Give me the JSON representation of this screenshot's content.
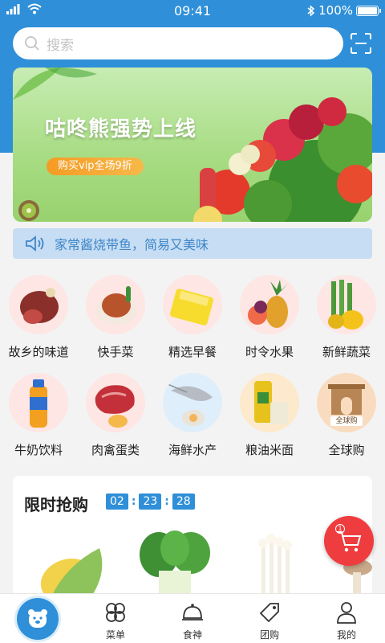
{
  "status_bar": {
    "time": "09:41",
    "battery": "100%"
  },
  "search": {
    "placeholder": "搜索"
  },
  "banner": {
    "title": "咕咚熊强势上线",
    "tag": "购买vip全场9折"
  },
  "notice": {
    "text": "家常酱烧带鱼，简易又美味"
  },
  "categories": [
    {
      "label": "故乡的味道"
    },
    {
      "label": "快手菜"
    },
    {
      "label": "精选早餐"
    },
    {
      "label": "时令水果"
    },
    {
      "label": "新鲜蔬菜"
    },
    {
      "label": "牛奶饮料"
    },
    {
      "label": "肉禽蛋类"
    },
    {
      "label": "海鲜水产"
    },
    {
      "label": "粮油米面"
    },
    {
      "label": "全球购",
      "badge": "全球购"
    }
  ],
  "flash_sale": {
    "title": "限时抢购",
    "hours": "02",
    "minutes": "23",
    "seconds": "28"
  },
  "cart": {
    "count": "1"
  },
  "tabbar": [
    {
      "label": ""
    },
    {
      "label": "菜单"
    },
    {
      "label": "食神"
    },
    {
      "label": "团购"
    },
    {
      "label": "我的"
    }
  ],
  "colors": {
    "primary": "#2f8fd8",
    "accent": "#ef3d3f",
    "notice_bg": "#c6ddf3"
  }
}
